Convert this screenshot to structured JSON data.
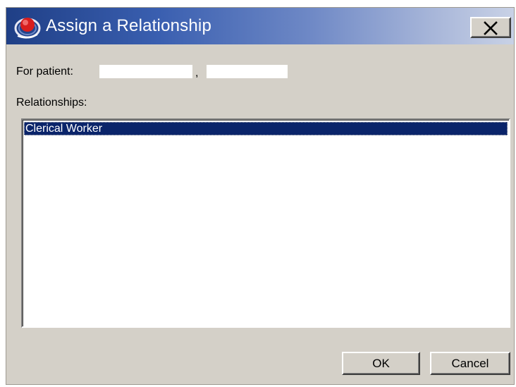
{
  "window": {
    "title": "Assign a Relationship",
    "title_icon": "app-logo-icon",
    "close_icon": "close-icon"
  },
  "patient": {
    "label": "For patient:",
    "last_name": "",
    "separator": ",",
    "first_name": ""
  },
  "relationships": {
    "label": "Relationships:",
    "items": [
      {
        "label": "Clerical Worker",
        "selected": true
      }
    ]
  },
  "buttons": {
    "ok_label": "OK",
    "cancel_label": "Cancel"
  },
  "colors": {
    "titlebar_start": "#1f3f86",
    "titlebar_end": "#c9d2e6",
    "dialog_background": "#d4d0c8",
    "selection": "#0a246a"
  }
}
